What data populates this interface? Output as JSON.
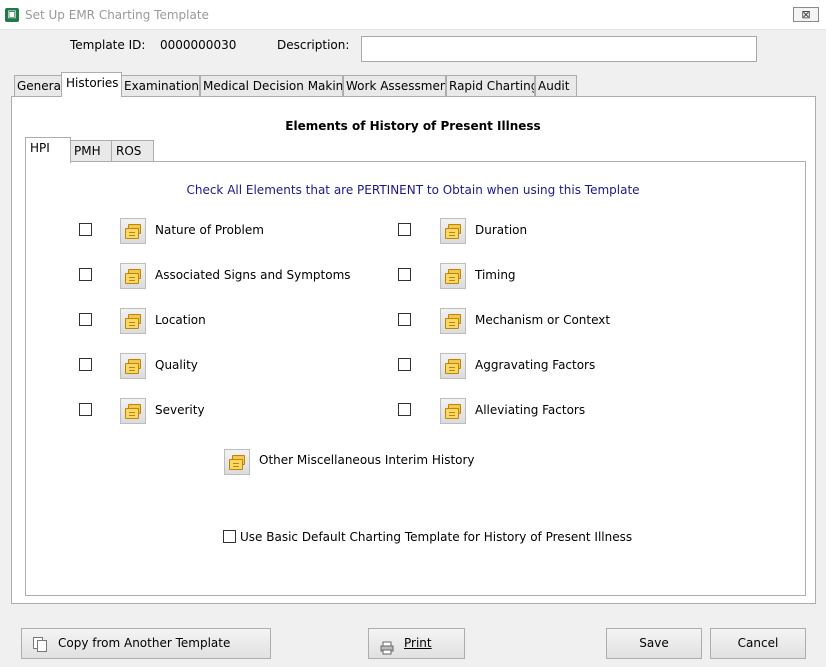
{
  "window": {
    "title": "Set Up EMR Charting Template",
    "close_label": "⊠"
  },
  "header": {
    "template_id_label": "Template ID:",
    "template_id_value": "0000000030",
    "description_label": "Description:",
    "description_value": ""
  },
  "tabs": [
    "General",
    "Histories",
    "Examinations",
    "Medical Decision Making",
    "Work Assessment",
    "Rapid Charting",
    "Audit"
  ],
  "active_tab": "Histories",
  "section_title": "Elements of History of Present Illness",
  "subtabs": [
    "HPI",
    "PMH",
    "ROS"
  ],
  "active_subtab": "HPI",
  "instruction": "Check All Elements that are PERTINENT to Obtain when using this Template",
  "elements_left": [
    {
      "label": "Nature of Problem",
      "checked": false
    },
    {
      "label": "Associated Signs and Symptoms",
      "checked": false
    },
    {
      "label": "Location",
      "checked": false
    },
    {
      "label": "Quality",
      "checked": false
    },
    {
      "label": "Severity",
      "checked": false
    }
  ],
  "elements_right": [
    {
      "label": "Duration",
      "checked": false
    },
    {
      "label": "Timing",
      "checked": false
    },
    {
      "label": "Mechanism or Context",
      "checked": false
    },
    {
      "label": "Aggravating Factors",
      "checked": false
    },
    {
      "label": "Alleviating Factors",
      "checked": false
    }
  ],
  "misc": {
    "label": "Other Miscellaneous Interim History"
  },
  "default_template": {
    "label": "Use Basic Default Charting Template for History of Present Illness",
    "checked": false
  },
  "footer": {
    "copy_label": "Copy from Another Template",
    "print_label": "Print",
    "save_label": "Save",
    "cancel_label": "Cancel"
  },
  "icons": {
    "app": "app-logo-icon",
    "element": "folder-copy-icon",
    "copy": "copy-document-icon",
    "print": "printer-icon"
  },
  "colors": {
    "instruction_text": "#1a1a8c",
    "folder": "#f5c84c",
    "app_icon": "#1f7a4a"
  }
}
